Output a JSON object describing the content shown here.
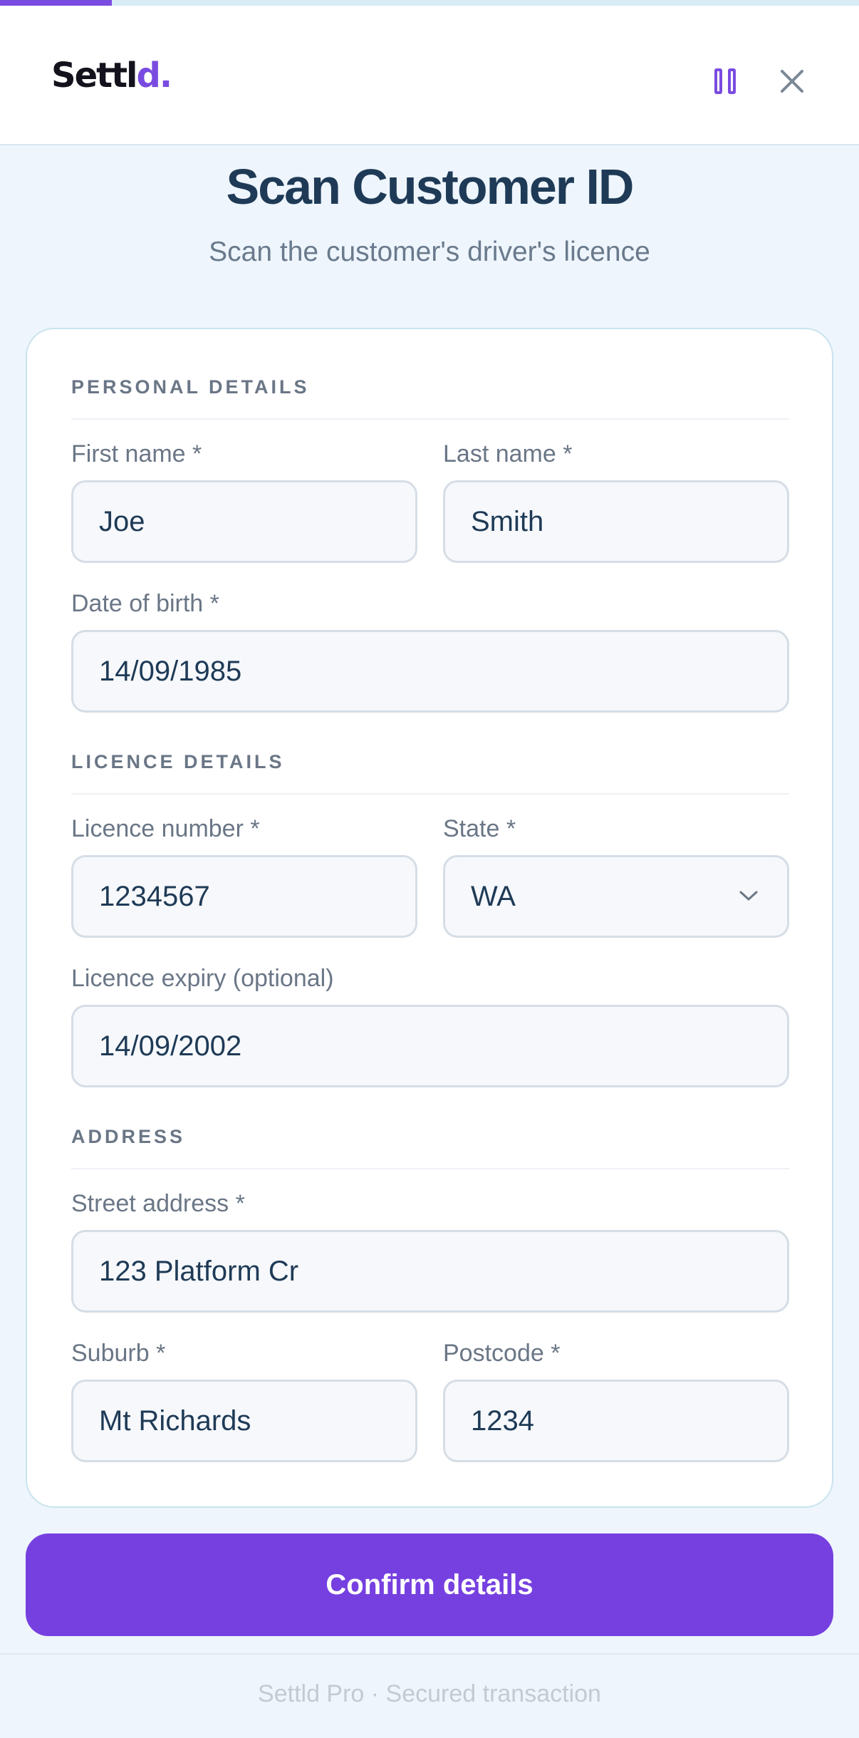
{
  "app": {
    "logo_main": "Settl",
    "logo_accent": "d.",
    "progress_fraction": 0.13,
    "accent_color": "#7a4be0"
  },
  "header": {
    "pause_icon": "pause-icon",
    "close_icon": "close-icon"
  },
  "page": {
    "title": "Scan Customer ID",
    "subtitle": "Scan the customer's driver's licence"
  },
  "sections": {
    "personal": "PERSONAL DETAILS",
    "licence": "LICENCE DETAILS",
    "address": "ADDRESS"
  },
  "fields": {
    "first_name": {
      "label": "First name *",
      "value": "Joe"
    },
    "last_name": {
      "label": "Last name *",
      "value": "Smith"
    },
    "dob": {
      "label": "Date of birth *",
      "value": "14/09/1985"
    },
    "licence_number": {
      "label": "Licence number *",
      "value": "1234567"
    },
    "state": {
      "label": "State *",
      "value": "WA"
    },
    "licence_expiry": {
      "label": "Licence expiry (optional)",
      "value": "14/09/2002"
    },
    "street": {
      "label": "Street address *",
      "value": "123 Platform Cr"
    },
    "suburb": {
      "label": "Suburb *",
      "value": "Mt Richards"
    },
    "postcode": {
      "label": "Postcode *",
      "value": "1234"
    }
  },
  "actions": {
    "confirm_label": "Confirm details"
  },
  "footer": {
    "text": "Settld Pro · Secured transaction"
  }
}
